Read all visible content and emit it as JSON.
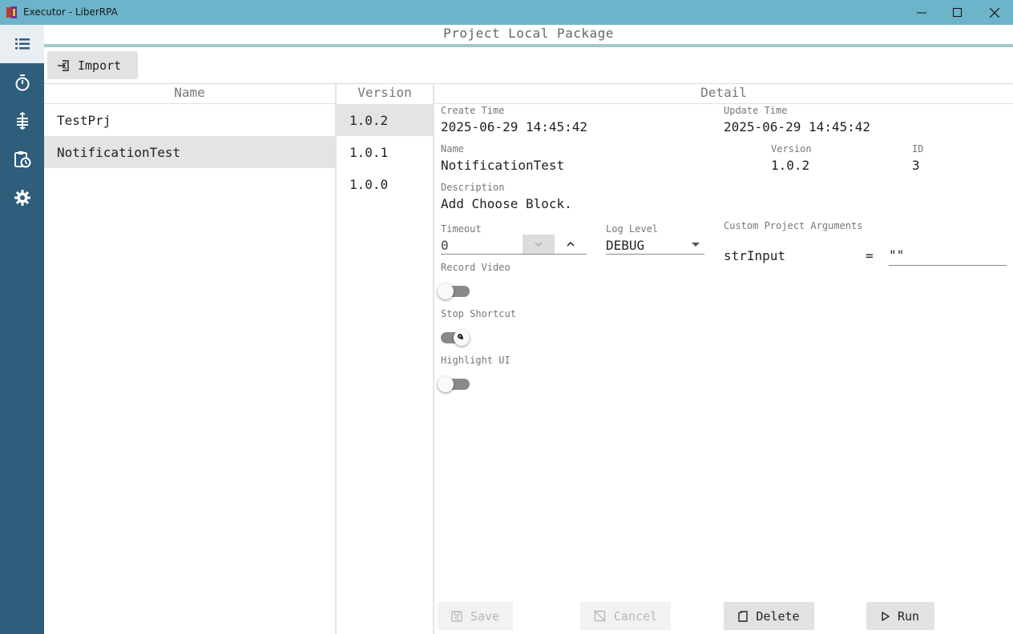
{
  "window": {
    "title": "Executor - LiberRPA",
    "icons": {
      "app": "liberrpa-logo-icon",
      "minimize": "minimize-icon",
      "maximize": "maximize-icon",
      "close": "close-icon"
    },
    "colors": {
      "titlebar": "#6db3c9",
      "nav": "#2f5d7c"
    }
  },
  "nav": {
    "items": [
      {
        "icon": "list-icon",
        "active": true
      },
      {
        "icon": "timer-icon",
        "active": false
      },
      {
        "icon": "log-icon",
        "active": false
      },
      {
        "icon": "schedule-icon",
        "active": false
      },
      {
        "icon": "settings-gear-icon",
        "active": false
      }
    ]
  },
  "header": {
    "title": "Project Local Package",
    "import_label": "Import"
  },
  "columns": {
    "name": "Name",
    "version": "Version",
    "detail": "Detail"
  },
  "projects": [
    {
      "name": "TestPrj",
      "selected": false
    },
    {
      "name": "NotificationTest",
      "selected": true
    }
  ],
  "versions": [
    {
      "label": "1.0.2",
      "selected": true
    },
    {
      "label": "1.0.1",
      "selected": false
    },
    {
      "label": "1.0.0",
      "selected": false
    }
  ],
  "detail": {
    "create_time_label": "Create Time",
    "create_time": "2025-06-29 14:45:42",
    "update_time_label": "Update Time",
    "update_time": "2025-06-29 14:45:42",
    "name_label": "Name",
    "name": "NotificationTest",
    "version_label": "Version",
    "version": "1.0.2",
    "id_label": "ID",
    "id": "3",
    "description_label": "Description",
    "description": "Add Choose Block.",
    "timeout_label": "Timeout",
    "timeout": "0",
    "log_level_label": "Log Level",
    "log_level": "DEBUG",
    "custom_args_label": "Custom Project Arguments",
    "custom_args": [
      {
        "name": "strInput",
        "equals": "=",
        "value": "\"\""
      }
    ],
    "record_video_label": "Record Video",
    "record_video": false,
    "stop_shortcut_label": "Stop Shortcut",
    "stop_shortcut": true,
    "highlight_ui_label": "Highlight UI",
    "highlight_ui": false
  },
  "actions": {
    "save": {
      "label": "Save",
      "enabled": false
    },
    "cancel": {
      "label": "Cancel",
      "enabled": false
    },
    "delete": {
      "label": "Delete",
      "enabled": true
    },
    "run": {
      "label": "Run",
      "enabled": true
    }
  }
}
